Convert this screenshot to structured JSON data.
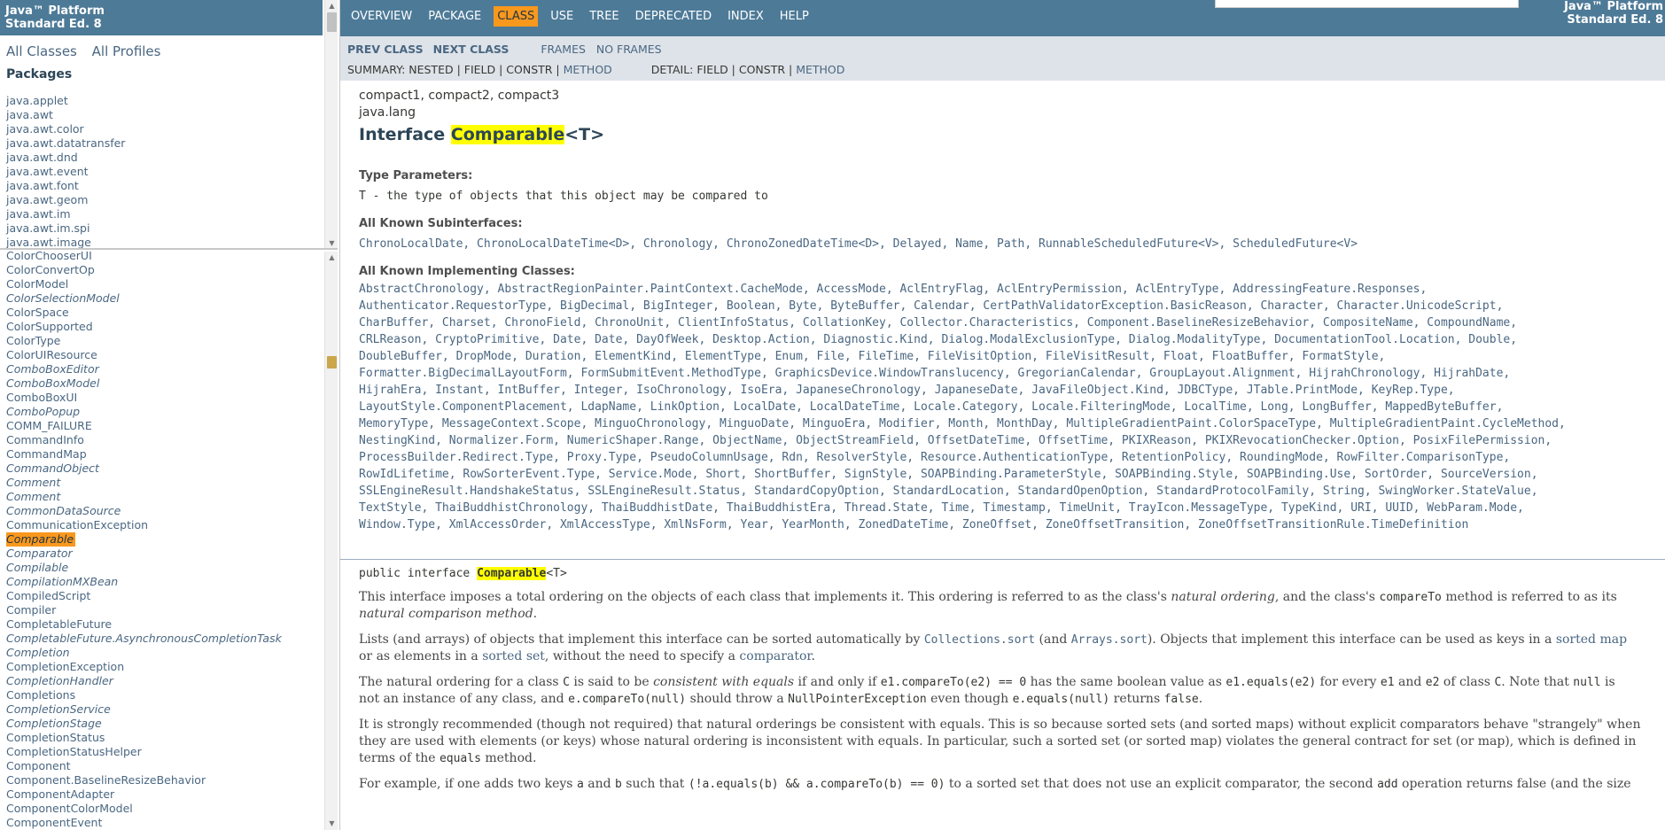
{
  "left": {
    "header_line1": "Java™ Platform",
    "header_line2": "Standard Ed. 8",
    "all_classes": "All Classes",
    "all_profiles": "All Profiles",
    "packages_heading": "Packages",
    "packages": [
      "java.applet",
      "java.awt",
      "java.awt.color",
      "java.awt.datatransfer",
      "java.awt.dnd",
      "java.awt.event",
      "java.awt.font",
      "java.awt.geom",
      "java.awt.im",
      "java.awt.im.spi",
      "java.awt.image"
    ],
    "classes": [
      {
        "name": "ColorChooserUI",
        "italic": false
      },
      {
        "name": "ColorConvertOp",
        "italic": false
      },
      {
        "name": "ColorModel",
        "italic": false
      },
      {
        "name": "ColorSelectionModel",
        "italic": true
      },
      {
        "name": "ColorSpace",
        "italic": false
      },
      {
        "name": "ColorSupported",
        "italic": false
      },
      {
        "name": "ColorType",
        "italic": false
      },
      {
        "name": "ColorUIResource",
        "italic": false
      },
      {
        "name": "ComboBoxEditor",
        "italic": true
      },
      {
        "name": "ComboBoxModel",
        "italic": true
      },
      {
        "name": "ComboBoxUI",
        "italic": false
      },
      {
        "name": "ComboPopup",
        "italic": true
      },
      {
        "name": "COMM_FAILURE",
        "italic": false
      },
      {
        "name": "CommandInfo",
        "italic": false
      },
      {
        "name": "CommandMap",
        "italic": false
      },
      {
        "name": "CommandObject",
        "italic": true
      },
      {
        "name": "Comment",
        "italic": true
      },
      {
        "name": "Comment",
        "italic": true
      },
      {
        "name": "CommonDataSource",
        "italic": true
      },
      {
        "name": "CommunicationException",
        "italic": false
      },
      {
        "name": "Comparable",
        "italic": true,
        "selected": true
      },
      {
        "name": "Comparator",
        "italic": true
      },
      {
        "name": "Compilable",
        "italic": true
      },
      {
        "name": "CompilationMXBean",
        "italic": true
      },
      {
        "name": "CompiledScript",
        "italic": false
      },
      {
        "name": "Compiler",
        "italic": false
      },
      {
        "name": "CompletableFuture",
        "italic": false
      },
      {
        "name": "CompletableFuture.AsynchronousCompletionTask",
        "italic": true
      },
      {
        "name": "Completion",
        "italic": true
      },
      {
        "name": "CompletionException",
        "italic": false
      },
      {
        "name": "CompletionHandler",
        "italic": true
      },
      {
        "name": "Completions",
        "italic": false
      },
      {
        "name": "CompletionService",
        "italic": true
      },
      {
        "name": "CompletionStage",
        "italic": true
      },
      {
        "name": "CompletionStatus",
        "italic": false
      },
      {
        "name": "CompletionStatusHelper",
        "italic": false
      },
      {
        "name": "Component",
        "italic": false
      },
      {
        "name": "Component.BaselineResizeBehavior",
        "italic": false
      },
      {
        "name": "ComponentAdapter",
        "italic": false
      },
      {
        "name": "ComponentColorModel",
        "italic": false
      },
      {
        "name": "ComponentEvent",
        "italic": false
      }
    ]
  },
  "nav": {
    "items": [
      {
        "label": "OVERVIEW",
        "current": false
      },
      {
        "label": "PACKAGE",
        "current": false
      },
      {
        "label": "CLASS",
        "current": true
      },
      {
        "label": "USE",
        "current": false
      },
      {
        "label": "TREE",
        "current": false
      },
      {
        "label": "DEPRECATED",
        "current": false
      },
      {
        "label": "INDEX",
        "current": false
      },
      {
        "label": "HELP",
        "current": false
      }
    ],
    "right_line1": "Java™ Platform",
    "right_line2": "Standard Ed. 8",
    "prev_class": "PREV CLASS",
    "next_class": "NEXT CLASS",
    "frames": "FRAMES",
    "no_frames": "NO FRAMES",
    "summary_prefix": "SUMMARY: NESTED | FIELD | CONSTR | ",
    "summary_method": "METHOD",
    "detail_prefix": "DETAIL: FIELD | CONSTR | ",
    "detail_method": "METHOD"
  },
  "content": {
    "profiles": "compact1, compact2, compact3",
    "package": "java.lang",
    "title_prefix": "Interface ",
    "title_name": "Comparable",
    "title_suffix": "<T>",
    "type_params_heading": "Type Parameters:",
    "type_param": "T - the type of objects that this object may be compared to",
    "subinterfaces_heading": "All Known Subinterfaces:",
    "subinterfaces": "ChronoLocalDate, ChronoLocalDateTime<D>, Chronology, ChronoZonedDateTime<D>, Delayed, Name, Path, RunnableScheduledFuture<V>, ScheduledFuture<V>",
    "implementing_heading": "All Known Implementing Classes:",
    "implementing_lines": [
      "AbstractChronology, AbstractRegionPainter.PaintContext.CacheMode, AccessMode, AclEntryFlag, AclEntryPermission, AclEntryType, AddressingFeature.Responses,",
      "Authenticator.RequestorType, BigDecimal, BigInteger, Boolean, Byte, ByteBuffer, Calendar, CertPathValidatorException.BasicReason, Character, Character.UnicodeScript,",
      "CharBuffer, Charset, ChronoField, ChronoUnit, ClientInfoStatus, CollationKey, Collector.Characteristics, Component.BaselineResizeBehavior, CompositeName, CompoundName,",
      "CRLReason, CryptoPrimitive, Date, Date, DayOfWeek, Desktop.Action, Diagnostic.Kind, Dialog.ModalExclusionType, Dialog.ModalityType, DocumentationTool.Location, Double,",
      "DoubleBuffer, DropMode, Duration, ElementKind, ElementType, Enum, File, FileTime, FileVisitOption, FileVisitResult, Float, FloatBuffer, FormatStyle,",
      "Formatter.BigDecimalLayoutForm, FormSubmitEvent.MethodType, GraphicsDevice.WindowTranslucency, GregorianCalendar, GroupLayout.Alignment, HijrahChronology, HijrahDate,",
      "HijrahEra, Instant, IntBuffer, Integer, IsoChronology, IsoEra, JapaneseChronology, JapaneseDate, JavaFileObject.Kind, JDBCType, JTable.PrintMode, KeyRep.Type,",
      "LayoutStyle.ComponentPlacement, LdapName, LinkOption, LocalDate, LocalDateTime, Locale.Category, Locale.FilteringMode, LocalTime, Long, LongBuffer, MappedByteBuffer,",
      "MemoryType, MessageContext.Scope, MinguoChronology, MinguoDate, MinguoEra, Modifier, Month, MonthDay, MultipleGradientPaint.ColorSpaceType, MultipleGradientPaint.CycleMethod,",
      "NestingKind, Normalizer.Form, NumericShaper.Range, ObjectName, ObjectStreamField, OffsetDateTime, OffsetTime, PKIXReason, PKIXRevocationChecker.Option, PosixFilePermission,",
      "ProcessBuilder.Redirect.Type, Proxy.Type, PseudoColumnUsage, Rdn, ResolverStyle, Resource.AuthenticationType, RetentionPolicy, RoundingMode, RowFilter.ComparisonType,",
      "RowIdLifetime, RowSorterEvent.Type, Service.Mode, Short, ShortBuffer, SignStyle, SOAPBinding.ParameterStyle, SOAPBinding.Style, SOAPBinding.Use, SortOrder, SourceVersion,",
      "SSLEngineResult.HandshakeStatus, SSLEngineResult.Status, StandardCopyOption, StandardLocation, StandardOpenOption, StandardProtocolFamily, String, SwingWorker.StateValue,",
      "TextStyle, ThaiBuddhistChronology, ThaiBuddhistDate, ThaiBuddhistEra, Thread.State, Time, Timestamp, TimeUnit, TrayIcon.MessageType, TypeKind, URI, UUID, WebParam.Mode,",
      "Window.Type, XmlAccessOrder, XmlAccessType, XmlNsForm, Year, YearMonth, ZonedDateTime, ZoneOffset, ZoneOffsetTransition, ZoneOffsetTransitionRule.TimeDefinition"
    ],
    "sig_prefix": "public interface ",
    "sig_name": "Comparable",
    "sig_suffix": "<T>",
    "p1_a": "This interface imposes a total ordering on the objects of each class that implements it. This ordering is referred to as the class's ",
    "p1_b": "natural ordering",
    "p1_c": ", and the class's ",
    "p1_d": "compareTo",
    "p1_e": " method is referred to as its",
    "p1_f": "natural comparison method",
    "p1_g": ".",
    "p2_a": "Lists (and arrays) of objects that implement this interface can be sorted automatically by ",
    "p2_b": "Collections.sort",
    "p2_c": " (and ",
    "p2_d": "Arrays.sort",
    "p2_e": "). Objects that implement this interface can be used as keys in a ",
    "p2_f": "sorted map",
    "p2_g": "or as elements in a ",
    "p2_h": "sorted set",
    "p2_i": ", without the need to specify a ",
    "p2_j": "comparator",
    "p2_k": ".",
    "p3_a": "The natural ordering for a class ",
    "p3_b": "C",
    "p3_c": " is said to be ",
    "p3_d": "consistent with equals",
    "p3_e": " if and only if ",
    "p3_f": "e1.compareTo(e2) == 0",
    "p3_g": " has the same boolean value as ",
    "p3_h": "e1.equals(e2)",
    "p3_i": " for every ",
    "p3_j": "e1",
    "p3_k": " and ",
    "p3_l": "e2",
    "p3_m": " of class ",
    "p3_n": "C",
    "p3_o": ". Note that ",
    "p3_p": "null",
    "p3_q": " is",
    "p3_r": "not an instance of any class, and ",
    "p3_s": "e.compareTo(null)",
    "p3_t": " should throw a ",
    "p3_u": "NullPointerException",
    "p3_v": " even though ",
    "p3_w": "e.equals(null)",
    "p3_x": " returns ",
    "p3_y": "false",
    "p3_z": ".",
    "p4_line1": "It is strongly recommended (though not required) that natural orderings be consistent with equals. This is so because sorted sets (and sorted maps) without explicit comparators behave \"strangely\" when",
    "p4_line2": "they are used with elements (or keys) whose natural ordering is inconsistent with equals. In particular, such a sorted set (or sorted map) violates the general contract for set (or map), which is defined in",
    "p4_line3_a": "terms of the ",
    "p4_line3_b": "equals",
    "p4_line3_c": " method.",
    "p5_a": "For example, if one adds two keys ",
    "p5_b": "a",
    "p5_c": " and ",
    "p5_d": "b",
    "p5_e": " such that ",
    "p5_f": "(!a.equals(b) && a.compareTo(b) == 0)",
    "p5_g": " to a sorted set that does not use an explicit comparator, the second ",
    "p5_h": "add",
    "p5_i": " operation returns false (and the size"
  }
}
